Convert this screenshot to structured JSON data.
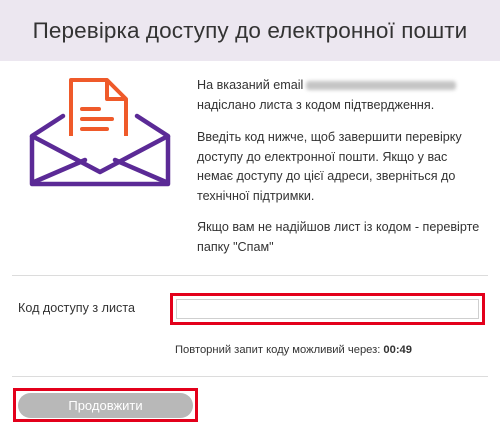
{
  "header": {
    "title": "Перевірка доступу до електронної пошти"
  },
  "colors": {
    "header_bg": "#ece7f0",
    "envelope_purple": "#5b2a96",
    "letter_orange": "#ef5a2a",
    "highlight_red": "#e3001b",
    "button_disabled": "#b8b8b8"
  },
  "illustration": {
    "icon": "envelope-with-letter-icon"
  },
  "info": {
    "sent_prefix": "На вказаний email",
    "sent_suffix": "надіслано листа з кодом підтвердження.",
    "instructions": "Введіть код нижче, щоб завершити перевірку доступу до електронної пошти. Якщо у вас немає доступу до цієї адреси, зверніться до технічної підтримки.",
    "spam_hint": "Якщо вам не надійшов лист із кодом - перевірте папку \"Спам\""
  },
  "code_form": {
    "label": "Код доступу з листа",
    "value": "",
    "placeholder": ""
  },
  "resend": {
    "text": "Повторний запит коду можливий через:",
    "timer": "00:49"
  },
  "continue_button": {
    "label": "Продовжити",
    "state": "disabled"
  }
}
